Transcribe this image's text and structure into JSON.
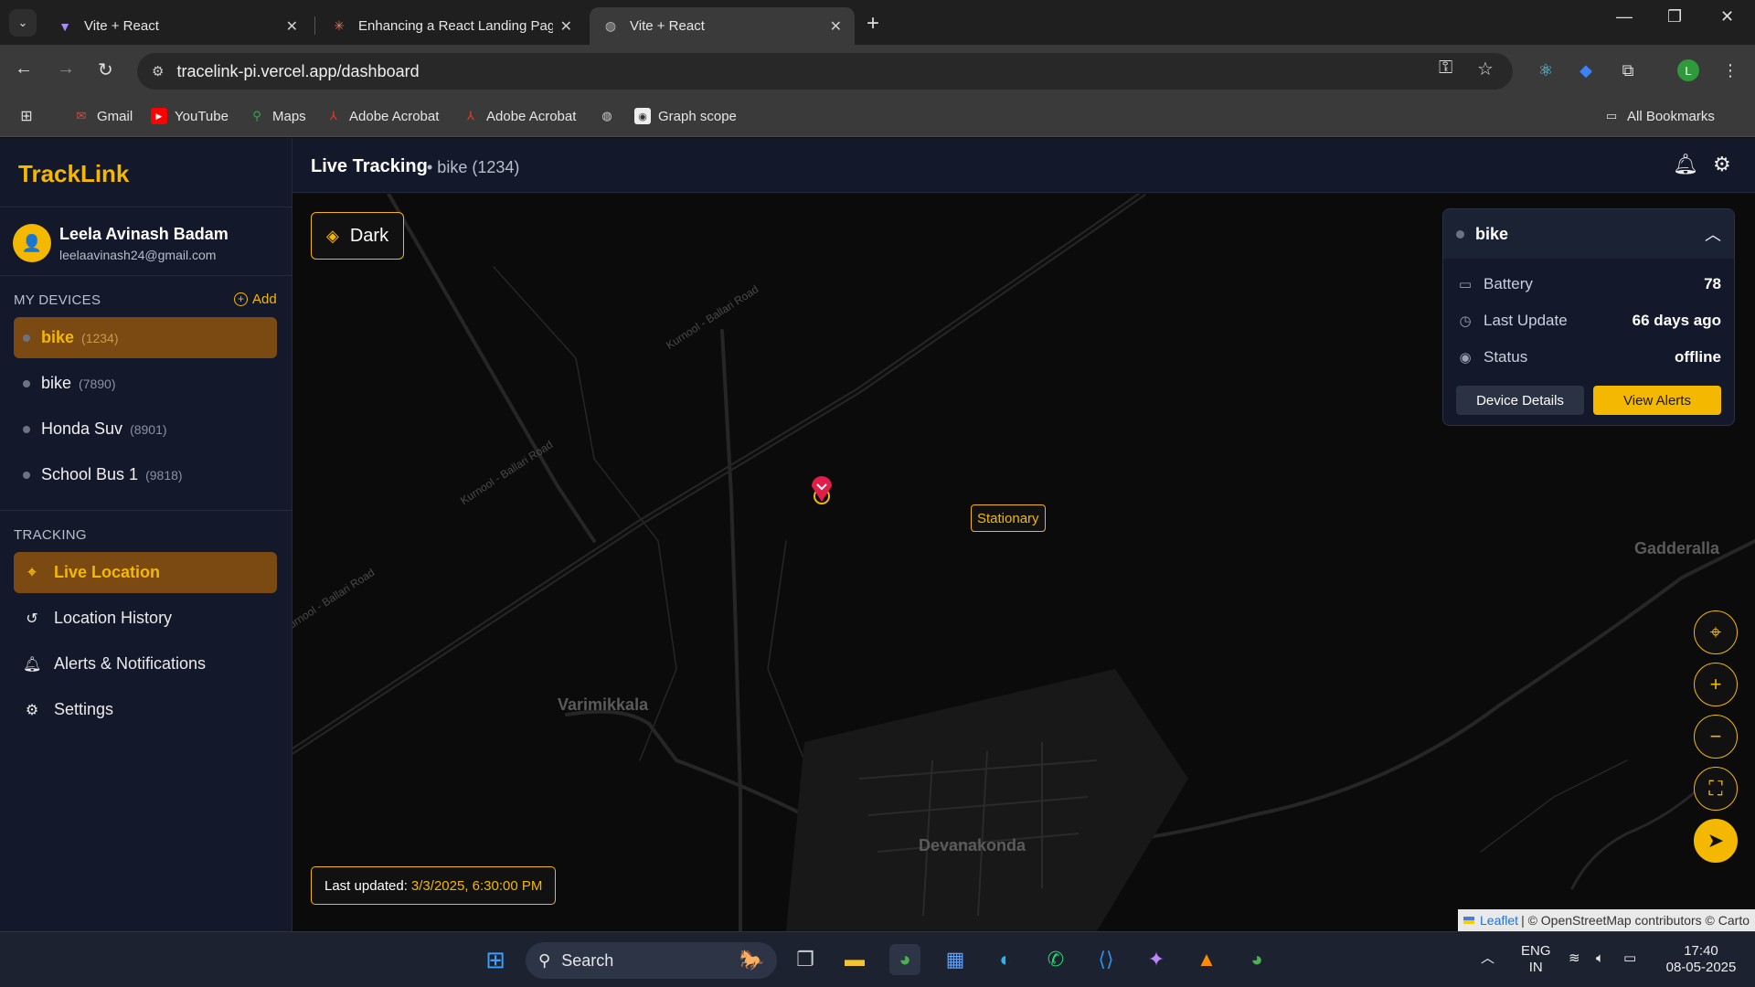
{
  "browser": {
    "tabs": [
      {
        "label": "Vite + React",
        "icon": "vite-icon"
      },
      {
        "label": "Enhancing a React Landing Page",
        "icon": "claude-icon"
      },
      {
        "label": "Vite + React",
        "icon": "globe-icon"
      }
    ],
    "url": "tracelink-pi.vercel.app/dashboard",
    "profile_initial": "L",
    "bookmarks": [
      "Gmail",
      "YouTube",
      "Maps",
      "Adobe Acrobat",
      "Adobe Acrobat",
      "Graph scope"
    ],
    "all_bookmarks": "All Bookmarks"
  },
  "app": {
    "brand": "TrackLink",
    "user": {
      "name": "Leela Avinash Badam",
      "email": "leelaavinash24@gmail.com"
    },
    "devices_title": "MY DEVICES",
    "add_label": "Add",
    "devices": [
      {
        "name": "bike",
        "id": "(1234)"
      },
      {
        "name": "bike",
        "id": "(7890)"
      },
      {
        "name": "Honda Suv",
        "id": "(8901)"
      },
      {
        "name": "School Bus 1",
        "id": "(9818)"
      }
    ],
    "tracking_title": "TRACKING",
    "nav": [
      {
        "label": "Live Location",
        "icon": "map-pin-icon"
      },
      {
        "label": "Location History",
        "icon": "history-icon"
      },
      {
        "label": "Alerts & Notifications",
        "icon": "bell-icon"
      },
      {
        "label": "Settings",
        "icon": "gear-icon"
      }
    ],
    "header": {
      "title": "Live Tracking",
      "subtitle": "• bike (1234)"
    },
    "map": {
      "layer_label": "Dark",
      "marker_label": "Stationary",
      "place_labels": [
        "Gadderalla",
        "Varimikkala",
        "Devanakonda"
      ],
      "road_label": "Kurnool - Ballari Road",
      "last_updated_label": "Last updated:",
      "last_updated_value": "3/3/2025, 6:30:00 PM",
      "attribution": {
        "leaflet": "Leaflet",
        "rest": "| © OpenStreetMap contributors © Carto"
      }
    },
    "panel": {
      "device_name": "bike",
      "rows": [
        {
          "label": "Battery",
          "value": "78",
          "icon": "battery-icon"
        },
        {
          "label": "Last Update",
          "value": "66 days ago",
          "icon": "clock-icon"
        },
        {
          "label": "Status",
          "value": "offline",
          "icon": "signal-icon"
        }
      ],
      "details_button": "Device Details",
      "alerts_button": "View Alerts"
    }
  },
  "taskbar": {
    "search_placeholder": "Search",
    "lang_top": "ENG",
    "lang_bottom": "IN",
    "time": "17:40",
    "date": "08-05-2025"
  },
  "colors": {
    "accent": "#f4b800",
    "sidebar": "#13192a",
    "active": "#7a4a12",
    "map_bg": "#0b0b0b"
  }
}
